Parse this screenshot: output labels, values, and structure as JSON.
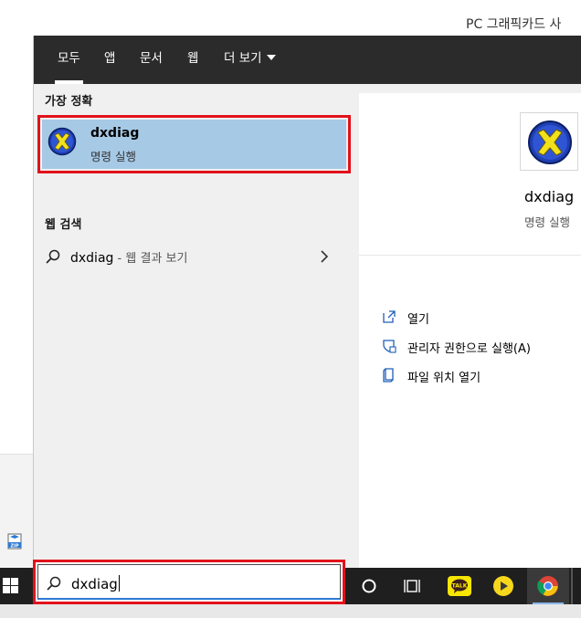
{
  "background": {
    "title": "PC 그래픽카드 사"
  },
  "menu": {
    "tabs": [
      {
        "label": "모두",
        "active": true
      },
      {
        "label": "앱"
      },
      {
        "label": "문서"
      },
      {
        "label": "웹"
      },
      {
        "label": "더 보기",
        "dropdown": true
      }
    ],
    "best_match": {
      "heading": "가장 정확",
      "name": "dxdiag",
      "type": "명령 실행"
    },
    "web_search": {
      "heading": "웹 검색",
      "query": "dxdiag",
      "suffix": " - 웹 결과 보기"
    },
    "detail": {
      "name": "dxdiag",
      "type": "명령 실행",
      "actions": [
        {
          "label": "열기",
          "icon": "open-icon"
        },
        {
          "label": "관리자 권한으로 실행(A)",
          "icon": "shield-icon"
        },
        {
          "label": "파일 위치 열기",
          "icon": "file-location-icon"
        }
      ]
    }
  },
  "taskbar": {
    "search_value": "dxdiag",
    "apps": [
      "cortana-icon",
      "task-view-icon",
      "kakaotalk-icon",
      "media-player-icon",
      "chrome-icon"
    ],
    "kakao_label": "TALK"
  },
  "colors": {
    "highlight": "#e1121c",
    "selection": "#a6c9e6",
    "menu_dark": "#2b2b2b",
    "taskbar": "#1f1f1f"
  }
}
